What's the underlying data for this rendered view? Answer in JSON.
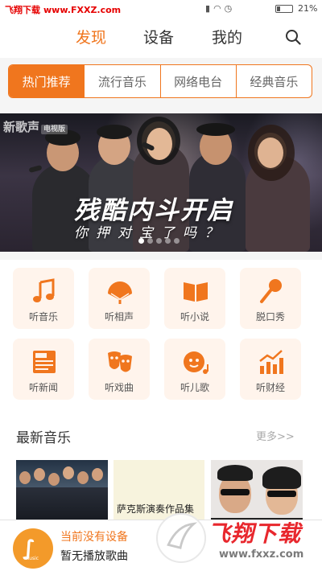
{
  "status_bar": {
    "watermark_name": "飞翔下载",
    "watermark_url": "www.FXXZ.com",
    "battery": "21%",
    "battery_level": 0.21
  },
  "nav": {
    "tabs": [
      {
        "label": "发现",
        "active": true
      },
      {
        "label": "设备",
        "active": false
      },
      {
        "label": "我的",
        "active": false
      }
    ],
    "search_icon": "search-icon"
  },
  "categories": [
    {
      "label": "热门推荐",
      "active": true
    },
    {
      "label": "流行音乐",
      "active": false
    },
    {
      "label": "网络电台",
      "active": false
    },
    {
      "label": "经典音乐",
      "active": false
    }
  ],
  "banner": {
    "logo": "新歌声",
    "logo_tag": "电视版",
    "title": "残酷内斗开启",
    "subtitle": "你押对宝了吗？",
    "slide_count": 5,
    "active_slide": 0
  },
  "grid": [
    {
      "label": "听音乐",
      "icon": "music-note-icon"
    },
    {
      "label": "听相声",
      "icon": "fan-icon"
    },
    {
      "label": "听小说",
      "icon": "book-icon"
    },
    {
      "label": "脱口秀",
      "icon": "microphone-icon"
    },
    {
      "label": "听新闻",
      "icon": "newspaper-icon"
    },
    {
      "label": "听戏曲",
      "icon": "opera-mask-icon"
    },
    {
      "label": "听儿歌",
      "icon": "child-face-icon"
    },
    {
      "label": "听财经",
      "icon": "chart-up-icon"
    }
  ],
  "newest": {
    "title": "最新音乐",
    "more": "更多>>",
    "albums": [
      {
        "caption": ""
      },
      {
        "caption": "萨克斯演奏作品集"
      },
      {
        "caption": ""
      }
    ]
  },
  "player": {
    "line1": "当前没有设备",
    "line2": "暂无播放歌曲",
    "logo_text": "Music"
  },
  "watermark_bottom": {
    "brand": "飞翔下载",
    "url": "www.fxxz.com"
  },
  "colors": {
    "accent": "#f0761e",
    "icon": "#f0761e",
    "watermark_red": "#e8272d"
  }
}
